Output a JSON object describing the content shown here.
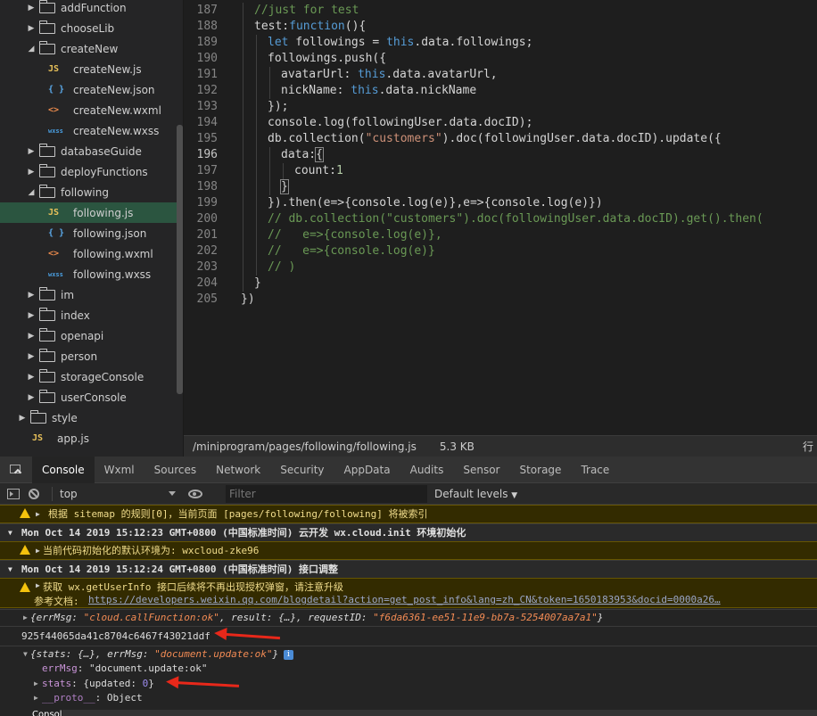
{
  "tree": {
    "items": [
      {
        "type": "folder",
        "state": "closed",
        "label": "addFunction"
      },
      {
        "type": "folder",
        "state": "closed",
        "label": "chooseLib"
      },
      {
        "type": "folder",
        "state": "open",
        "label": "createNew"
      },
      {
        "type": "js",
        "label": "createNew.js"
      },
      {
        "type": "json",
        "label": "createNew.json"
      },
      {
        "type": "wxml",
        "label": "createNew.wxml"
      },
      {
        "type": "wxss",
        "label": "createNew.wxss"
      },
      {
        "type": "folder",
        "state": "closed",
        "label": "databaseGuide"
      },
      {
        "type": "folder",
        "state": "closed",
        "label": "deployFunctions"
      },
      {
        "type": "folder",
        "state": "open",
        "label": "following"
      },
      {
        "type": "js",
        "label": "following.js",
        "active": true
      },
      {
        "type": "json",
        "label": "following.json"
      },
      {
        "type": "wxml",
        "label": "following.wxml"
      },
      {
        "type": "wxss",
        "label": "following.wxss"
      },
      {
        "type": "folder",
        "state": "closed",
        "label": "im"
      },
      {
        "type": "folder",
        "state": "closed",
        "label": "index"
      },
      {
        "type": "folder",
        "state": "closed",
        "label": "openapi"
      },
      {
        "type": "folder",
        "state": "closed",
        "label": "person"
      },
      {
        "type": "folder",
        "state": "closed",
        "label": "storageConsole"
      },
      {
        "type": "folder",
        "state": "closed",
        "label": "userConsole"
      },
      {
        "type": "folder",
        "state": "closed",
        "label": "style",
        "level": 0
      },
      {
        "type": "js",
        "label": "app.js",
        "level": 0
      }
    ],
    "icon_glyphs": {
      "js": "JS",
      "json": "{ }",
      "wxml": "<>",
      "wxss": "wxss"
    },
    "icon_colors": {
      "js": "#e8c15a",
      "json": "#5aa8e8",
      "wxml": "#e8894c",
      "wxss": "#4a9ee0"
    }
  },
  "editor": {
    "lines": [
      {
        "n": "187",
        "html": "<span style='color:#6a9955'>//just for test</span>",
        "indent": 1
      },
      {
        "n": "188",
        "html": "test:<span style='color:#569cd6'>function</span>(){",
        "indent": 1
      },
      {
        "n": "189",
        "html": "<span style='color:#569cd6'>let</span> followings = <span style='color:#569cd6'>this</span>.data.followings;",
        "indent": 2
      },
      {
        "n": "190",
        "html": "followings.push({",
        "indent": 2
      },
      {
        "n": "191",
        "html": "avatarUrl: <span style='color:#569cd6'>this</span>.data.avatarUrl,",
        "indent": 3
      },
      {
        "n": "192",
        "html": "nickName: <span style='color:#569cd6'>this</span>.data.nickName",
        "indent": 3
      },
      {
        "n": "193",
        "html": "});",
        "indent": 2
      },
      {
        "n": "194",
        "html": "console.log(followingUser.data.docID);",
        "indent": 2
      },
      {
        "n": "195",
        "html": "db.collection(<span style='color:#ce9178'>\"customers\"</span>).doc(followingUser.data.docID).update({",
        "indent": 2
      },
      {
        "n": "196",
        "html": "data:<span style='outline:1px solid #888'>{</span>",
        "indent": 3,
        "current": true
      },
      {
        "n": "197",
        "html": "count:<span style='color:#b5cea8'>1</span>",
        "indent": 4
      },
      {
        "n": "198",
        "html": "<span style='outline:1px solid #888'>}</span>",
        "indent": 3
      },
      {
        "n": "199",
        "html": "}).then(e=>{console.log(e)},e=>{console.log(e)})",
        "indent": 2
      },
      {
        "n": "200",
        "html": "<span style='color:#6a9955'>// db.collection(\"customers\").doc(followingUser.data.docID).get().then(</span>",
        "indent": 2
      },
      {
        "n": "201",
        "html": "<span style='color:#6a9955'>//   e=>{console.log(e)},</span>",
        "indent": 2
      },
      {
        "n": "202",
        "html": "<span style='color:#6a9955'>//   e=>{console.log(e)}</span>",
        "indent": 2
      },
      {
        "n": "203",
        "html": "<span style='color:#6a9955'>// )</span>",
        "indent": 2
      },
      {
        "n": "204",
        "html": "}",
        "indent": 1
      },
      {
        "n": "205",
        "html": "})",
        "indent": 0
      }
    ]
  },
  "status": {
    "path": "/miniprogram/pages/following/following.js",
    "size": "5.3 KB",
    "right": "行"
  },
  "devtools": {
    "tabs": [
      "Console",
      "Wxml",
      "Sources",
      "Network",
      "Security",
      "AppData",
      "Audits",
      "Sensor",
      "Storage",
      "Trace"
    ],
    "active_tab": "Console",
    "context": "top",
    "filter_placeholder": "Filter",
    "levels": "Default levels"
  },
  "console": {
    "sitemap": "根据 sitemap 的规则[0]，当前页面 [pages/following/following] 将被索引",
    "group1": "Mon Oct 14 2019 15:12:23 GMT+0800 (中国标准时间) 云开发 wx.cloud.init 环境初始化",
    "env_warn": "当前代码初始化的默认环境为: wxcloud-zke96",
    "group2": "Mon Oct 14 2019 15:12:24 GMT+0800 (中国标准时间) 接口调整",
    "userinfo_warn": "获取 wx.getUserInfo 接口后续将不再出现授权弹窗，请注意升级",
    "ref_label": "参考文档: ",
    "ref_url": "https://developers.weixin.qq.com/blogdetail?action=get_post_info&lang=zh_CN&token=1650183953&docid=0000a26…",
    "callfn_a": "{errMsg: ",
    "callfn_b": "\"cloud.callFunction:ok\"",
    "callfn_c": ", result: {…}, requestID: ",
    "callfn_d": "\"f6da6361-ee51-11e9-bb7a-5254007aa7a1\"",
    "callfn_e": "}",
    "docid": "925f44065da41c8704c6467f43021ddf",
    "update_a": "{stats: {…}, errMsg: ",
    "update_b": "\"document.update:ok\"",
    "update_c": "}",
    "errmsg_key": "errMsg",
    "errmsg_val": "\"document.update:ok\"",
    "stats_key": "stats",
    "stats_val_a": "{updated: ",
    "stats_val_n": "0",
    "stats_val_c": "}",
    "proto_key": "__proto__",
    "proto_val": "Object",
    "bottom_tab": "Console"
  }
}
